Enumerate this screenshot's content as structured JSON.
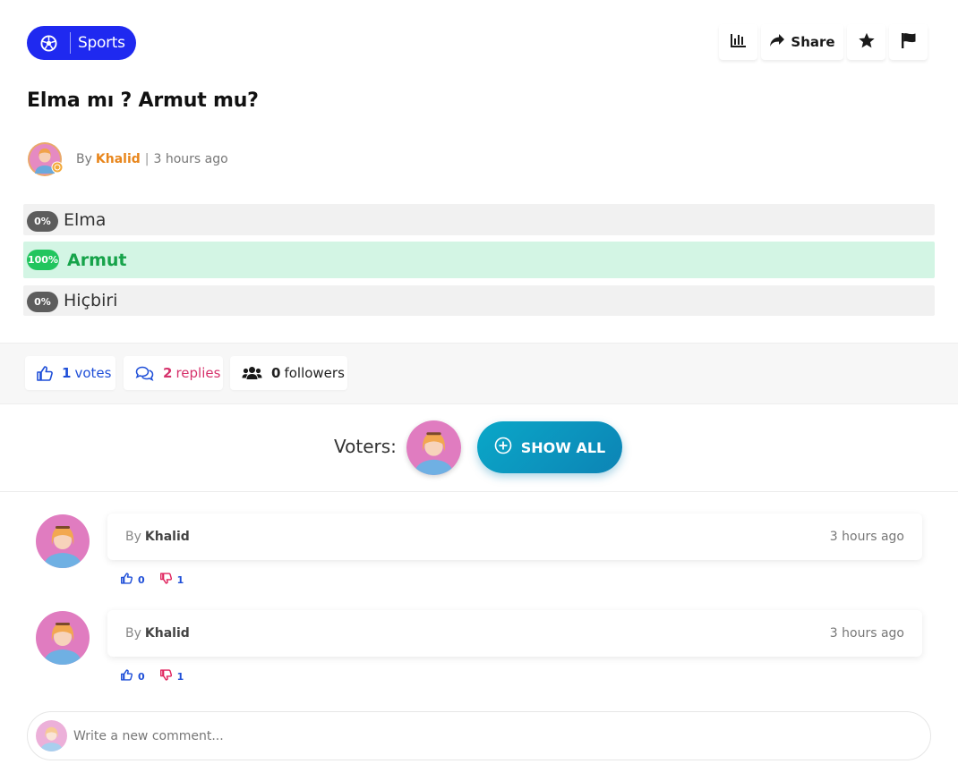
{
  "category": {
    "label": "Sports",
    "icon": "soccer-ball-icon",
    "color": "#1f29f0"
  },
  "toolbar": {
    "share_label": "Share"
  },
  "question": {
    "title": "Elma mı ? Armut mu?",
    "by": "By",
    "author": "Khalid",
    "separator": "|",
    "time": "3 hours ago"
  },
  "options": [
    {
      "percent": "0%",
      "label": "Elma",
      "value": 0,
      "winner": false
    },
    {
      "percent": "100%",
      "label": "Armut",
      "value": 100,
      "winner": true
    },
    {
      "percent": "0%",
      "label": "Hiçbiri",
      "value": 0,
      "winner": false
    }
  ],
  "stats": {
    "votes_count": "1",
    "votes_label": "votes",
    "replies_count": "2",
    "replies_label": "replies",
    "followers_count": "0",
    "followers_label": "followers"
  },
  "voters": {
    "label": "Voters:",
    "show_all_label": "SHOW ALL"
  },
  "comments": [
    {
      "by": "By",
      "author": "Khalid",
      "time": "3 hours ago",
      "likes": "0",
      "dislikes": "1"
    },
    {
      "by": "By",
      "author": "Khalid",
      "time": "3 hours ago",
      "likes": "0",
      "dislikes": "1"
    }
  ],
  "new_comment": {
    "placeholder": "Write a new comment..."
  },
  "colors": {
    "accent": "#1f29f0",
    "author": "#e8861c",
    "winner": "#22c55e",
    "winner_bg": "#d3f5e4",
    "replies": "#d6336c",
    "show_all": "#0d84b5"
  }
}
